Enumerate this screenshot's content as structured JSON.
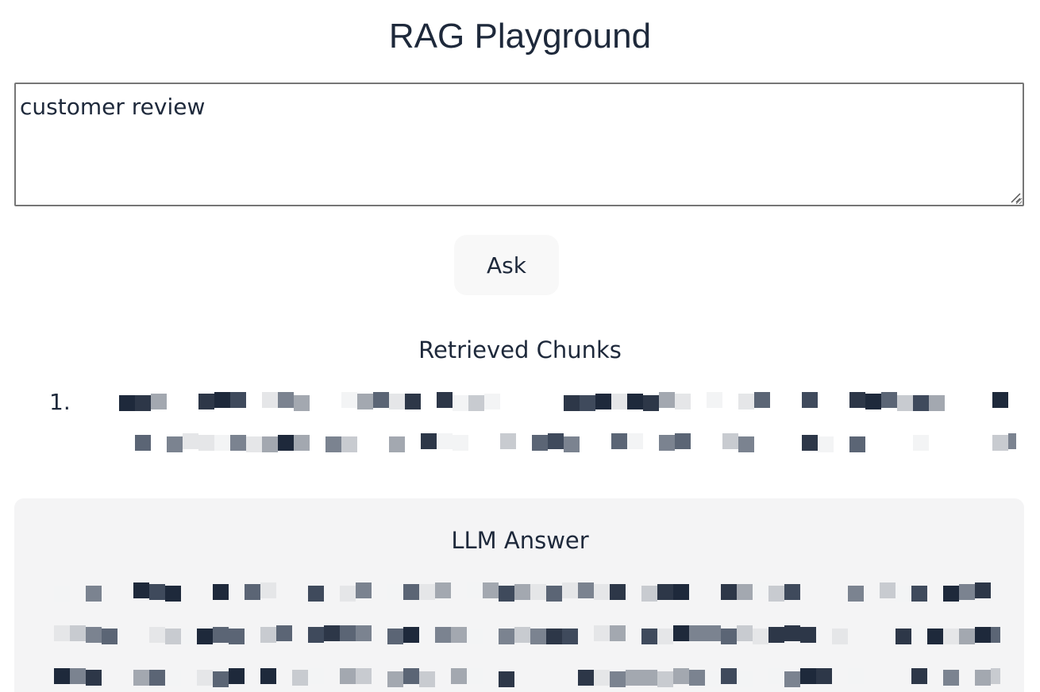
{
  "page": {
    "title": "RAG Playground"
  },
  "query": {
    "value": "customer review"
  },
  "ask_button": {
    "label": "Ask"
  },
  "chunks": {
    "heading": "Retrieved Chunks",
    "items": [
      {
        "number": "1."
      }
    ]
  },
  "answer": {
    "heading": "LLM Answer"
  },
  "colors": {
    "text": "#1e293b",
    "panel": "#f4f4f5",
    "button": "#f8f8f8",
    "border": "#767676"
  }
}
